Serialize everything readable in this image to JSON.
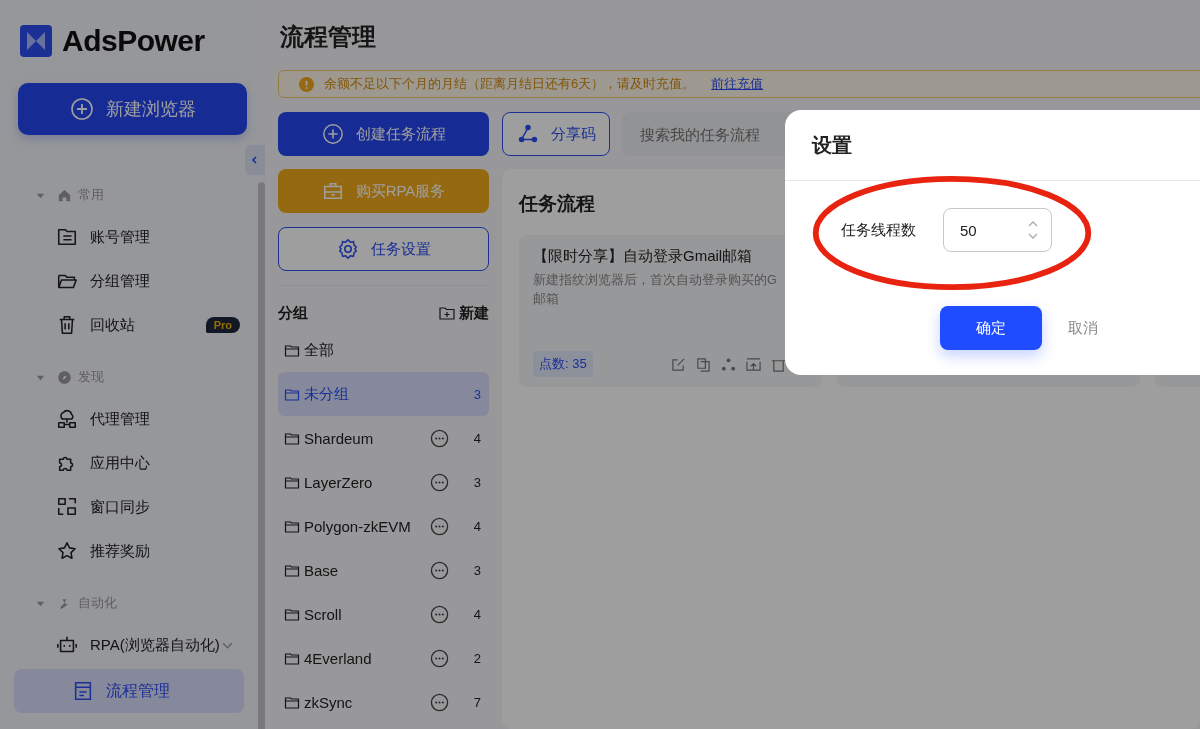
{
  "app": {
    "name": "AdsPower"
  },
  "new_browser_button": {
    "label": "新建浏览器"
  },
  "sidebar": {
    "sections": [
      {
        "title": "常用",
        "items": [
          {
            "label": "账号管理",
            "selected": false
          },
          {
            "label": "分组管理",
            "selected": false
          },
          {
            "label": "回收站",
            "selected": false,
            "badge": "Pro"
          }
        ]
      },
      {
        "title": "发现",
        "items": [
          {
            "label": "代理管理",
            "selected": false
          },
          {
            "label": "应用中心",
            "selected": false
          },
          {
            "label": "窗口同步",
            "selected": false
          },
          {
            "label": "推荐奖励",
            "selected": false
          }
        ]
      },
      {
        "title": "自动化",
        "items": [
          {
            "label": "RPA(浏览器自动化)",
            "selected": false,
            "expanded": true,
            "children": [
              {
                "label": "流程管理",
                "selected": true
              }
            ]
          }
        ]
      }
    ]
  },
  "page_title": "流程管理",
  "banner": {
    "text": "余额不足以下个月的月结（距离月结日还有6天），请及时充值。",
    "link": "前往充值"
  },
  "actions": {
    "create": "创建任务流程",
    "share": "分享码",
    "search_placeholder": "搜索我的任务流程",
    "buy": "购买RPA服务",
    "settings": "任务设置"
  },
  "groups": {
    "title": "分组",
    "new": "新建",
    "items": [
      {
        "name": "全部",
        "menu": false,
        "selected": false
      },
      {
        "name": "未分组",
        "count": "3",
        "menu": false,
        "selected": true
      },
      {
        "name": "Shardeum",
        "count": "4",
        "menu": true,
        "selected": false
      },
      {
        "name": "LayerZero",
        "count": "3",
        "menu": true,
        "selected": false
      },
      {
        "name": "Polygon-zkEVM",
        "count": "4",
        "menu": true,
        "selected": false
      },
      {
        "name": "Base",
        "count": "3",
        "menu": true,
        "selected": false
      },
      {
        "name": "Scroll",
        "count": "4",
        "menu": true,
        "selected": false
      },
      {
        "name": "4Everland",
        "count": "2",
        "menu": true,
        "selected": false
      },
      {
        "name": "zkSync",
        "count": "7",
        "menu": true,
        "selected": false
      }
    ]
  },
  "workflows": {
    "title": "任务流程",
    "cards": [
      {
        "title": "【限时分享】自动登录Gmail邮箱",
        "description_lines": [
          "新建指纹浏览器后，首次自动登录购买的G",
          "邮箱"
        ],
        "points": "点数: 35"
      }
    ]
  },
  "dialog": {
    "title": "设置",
    "field_label": "任务线程数",
    "value": "50",
    "ok": "确定",
    "cancel": "取消"
  }
}
